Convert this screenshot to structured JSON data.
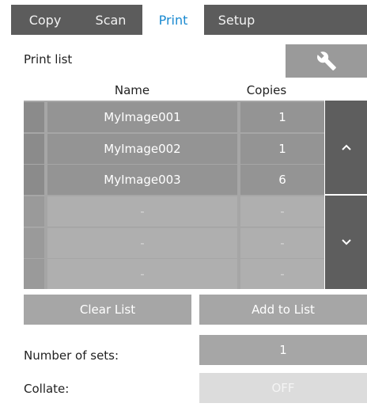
{
  "tabs": [
    {
      "label": "Copy"
    },
    {
      "label": "Scan"
    },
    {
      "label": "Print"
    },
    {
      "label": "Setup"
    }
  ],
  "print_list": {
    "label": "Print list",
    "settings_icon": "wrench-icon",
    "columns": {
      "name": "Name",
      "copies": "Copies"
    },
    "rows": [
      {
        "name": "MyImage001",
        "copies": "1"
      },
      {
        "name": "MyImage002",
        "copies": "1"
      },
      {
        "name": "MyImage003",
        "copies": "6"
      },
      {
        "name": "-",
        "copies": "-"
      },
      {
        "name": "-",
        "copies": "-"
      },
      {
        "name": "-",
        "copies": "-"
      }
    ],
    "scroll_up_icon": "chevron-up-icon",
    "scroll_down_icon": "chevron-down-icon"
  },
  "buttons": {
    "clear_list": "Clear List",
    "add_to_list": "Add to List"
  },
  "settings": {
    "number_of_sets_label": "Number of sets:",
    "number_of_sets_value": "1",
    "collate_label": "Collate:",
    "collate_value": "OFF"
  },
  "colors": {
    "active_tab": "#1a8ad1",
    "tab_bar": "#5c5c5c",
    "list_bg": "#a6a6a6"
  }
}
